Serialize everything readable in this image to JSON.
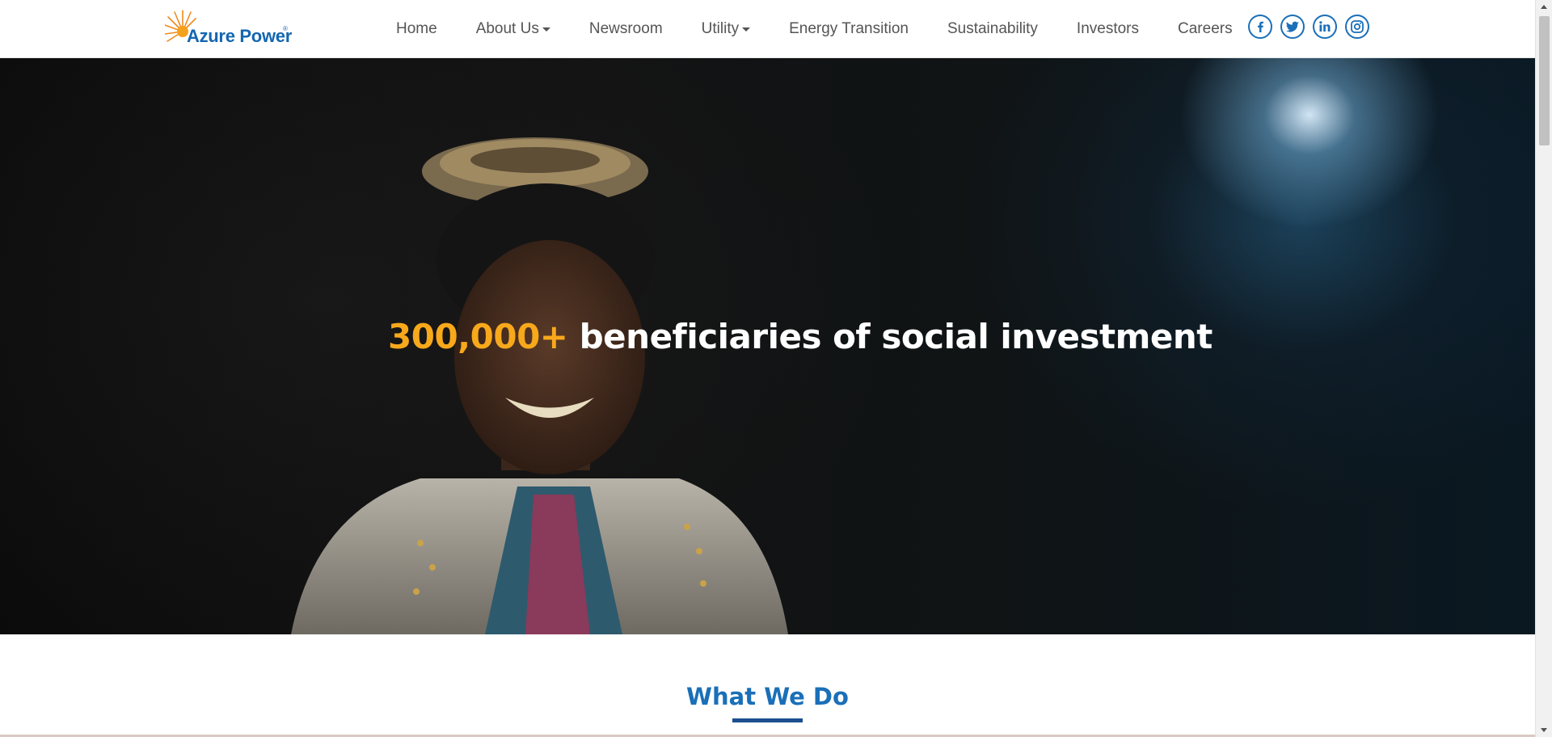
{
  "header": {
    "logo": {
      "text": "Azure Power",
      "reg": "®"
    },
    "nav": [
      {
        "label": "Home",
        "dropdown": false
      },
      {
        "label": "About Us",
        "dropdown": true
      },
      {
        "label": "Newsroom",
        "dropdown": false
      },
      {
        "label": "Utility",
        "dropdown": true
      },
      {
        "label": "Energy Transition",
        "dropdown": false
      },
      {
        "label": "Sustainability",
        "dropdown": false
      },
      {
        "label": "Investors",
        "dropdown": false
      },
      {
        "label": "Careers",
        "dropdown": false
      }
    ],
    "social": [
      "facebook-icon",
      "twitter-icon",
      "linkedin-icon",
      "instagram-icon"
    ]
  },
  "hero": {
    "highlight": "300,000+",
    "text": " beneficiaries of social investment"
  },
  "section": {
    "title": "What We Do"
  },
  "colors": {
    "brand_blue": "#1a6fb8",
    "accent_orange": "#f7a81b",
    "nav_text": "#555555"
  }
}
